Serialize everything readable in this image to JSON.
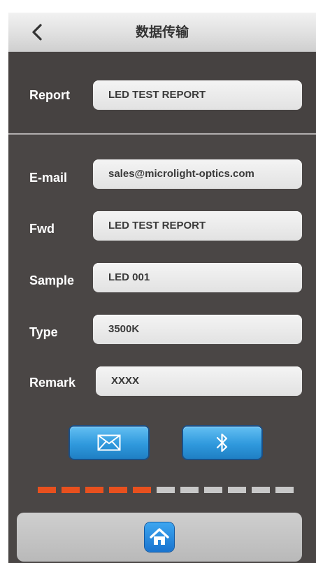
{
  "header": {
    "title": "数据传输",
    "back_icon": "chevron-left-icon"
  },
  "report": {
    "label": "Report",
    "value": "LED TEST REPORT"
  },
  "form": {
    "email": {
      "label": "E-mail",
      "value": "sales@microlight-optics.com"
    },
    "fwd": {
      "label": "Fwd",
      "value": "LED TEST REPORT"
    },
    "sample": {
      "label": "Sample",
      "value": "LED 001"
    },
    "type": {
      "label": "Type",
      "value": "3500K"
    },
    "remark": {
      "label": "Remark",
      "value": "XXXX"
    }
  },
  "actions": {
    "email_icon": "envelope-icon",
    "bluetooth_icon": "bluetooth-icon"
  },
  "progress": {
    "filled": 5,
    "total": 11,
    "filled_color": "#e8501e",
    "empty_color": "#c8c8c8"
  },
  "footer": {
    "home_icon": "home-icon"
  },
  "colors": {
    "background": "#4a4645",
    "accent": "#2f99dd"
  }
}
